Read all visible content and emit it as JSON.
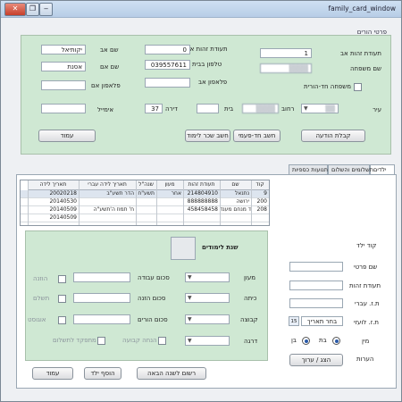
{
  "window": {
    "title": "family_card_window",
    "btn_minimize": "‒",
    "btn_restore": "❐",
    "btn_close": "✕"
  },
  "parents": {
    "legend": "פרטי הורים",
    "labels": {
      "family_code": "תעודת זהות אב",
      "family_name": "שם משפחה",
      "father_id": "תעודת זהות אם",
      "home_phone": "טלפון בבית",
      "father_name": "שם אב",
      "mother_name": "שם אם",
      "father_cell": "פלאפון אב",
      "mother_cell": "פלאפון אם",
      "single_parent": "משפחה חד-הורית",
      "street": "רחוב",
      "house": "בית",
      "apartment": "דירה",
      "city": "עיר",
      "email": "אימייל"
    },
    "values": {
      "family_code": "1",
      "family_name": "",
      "father_id": "0",
      "home_phone": "039557611",
      "father_name": "יקותיאל",
      "mother_name": "אסנת",
      "father_cell": "",
      "mother_cell": "",
      "street": "",
      "house": "",
      "apartment": "37",
      "city": "",
      "email": ""
    },
    "buttons": {
      "receive_payment": "קבלת הודעה",
      "single_parent_calc": "חשב חד-פעמי",
      "calc_payment": "חשב שכר לימוד",
      "next": "עמוד"
    }
  },
  "tabs": [
    "ילדים",
    "תשלומים והשלום",
    "תנועות כספיות"
  ],
  "grid": {
    "headers": [
      "קוד",
      "שם",
      "תעודת זהות",
      "מעון",
      "שנה\"ל",
      "תאריך לידה עברי",
      "תאריך לידה"
    ],
    "rows": [
      [
        "9",
        "נתנאל",
        "214804910",
        "אחר",
        "תשע\"ח",
        "הדר תשע\"ב",
        "20020218"
      ],
      [
        "200",
        "ירושה",
        "888888888",
        "",
        "",
        "",
        "20140530"
      ],
      [
        "208",
        "דוד מנחם מענד",
        "458458458",
        "",
        "",
        "ח' תמוז ה'תשע\"ה",
        "20140509"
      ],
      [
        "",
        "",
        "",
        "",
        "",
        "",
        "20140509"
      ]
    ]
  },
  "child": {
    "labels": {
      "child_code": "קוד ילד",
      "first_name": "שם פרטי",
      "id": "תעודת זהות",
      "heb_date": "ת.ז. עברי",
      "birth_date": "ת.ז. לועזי",
      "gender": "מין",
      "notes": "הערות",
      "male": "בן",
      "female": "בת"
    },
    "pick_date": "בחר תאריך",
    "calendar_day": "15",
    "update_button": "הצג / ערוך"
  },
  "study": {
    "legend": "שנת לימודים",
    "labels": {
      "kindergarten": "מעון",
      "class": "כיתה",
      "group": "קבוצה",
      "level": "דרגה",
      "work_hours": "סכום עבודה",
      "eating_hours": "סכום הזנה",
      "parents_hours": "סכום הורים",
      "fixed_discount": "הנחה קבועה",
      "approved": "הוזנה",
      "paid": "תשלם",
      "august": "אוגוסט",
      "other_discount": "מתפקד לתשלום"
    }
  },
  "footer_buttons": {
    "register_next": "רשום לשנה הבאה",
    "add_child": "הוסף ילד",
    "page": "עמוד"
  }
}
